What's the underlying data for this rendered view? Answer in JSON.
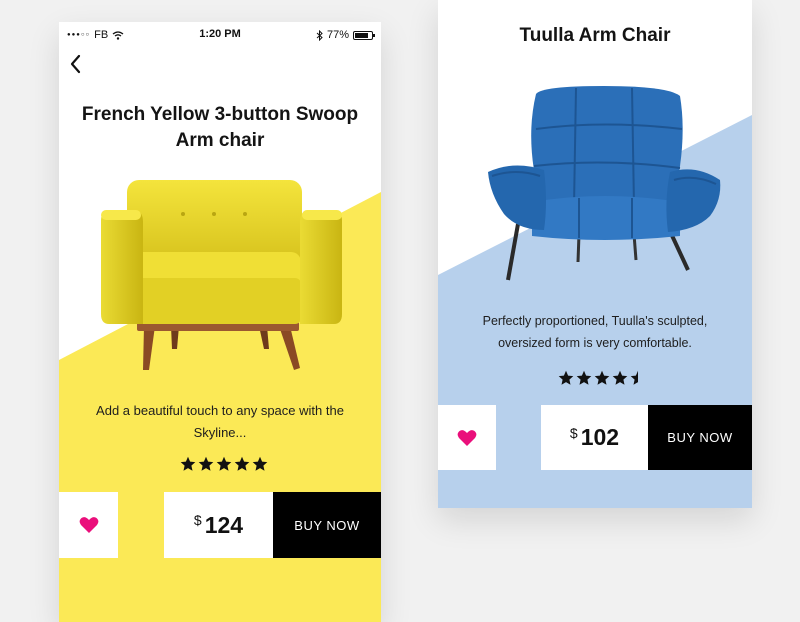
{
  "status_bar": {
    "carrier": "FB",
    "time": "1:20 PM",
    "battery": "77%"
  },
  "left_card": {
    "title": "French Yellow 3-button Swoop Arm chair",
    "description": "Add a beautiful touch to any space with the Skyline...",
    "rating": 5,
    "currency": "$",
    "price": "124",
    "buy_label": "BUY NOW",
    "accent_color": "#fbe956"
  },
  "right_card": {
    "title": "Tuulla Arm Chair",
    "description": "Perfectly proportioned, Tuulla's sculpted, oversized form is very comfortable.",
    "rating": 4.5,
    "currency": "$",
    "price": "102",
    "buy_label": "BUY NOW",
    "accent_color": "#b7d0ec"
  },
  "colors": {
    "heart": "#ea0f7b",
    "page_background": "#f1f1f1"
  }
}
